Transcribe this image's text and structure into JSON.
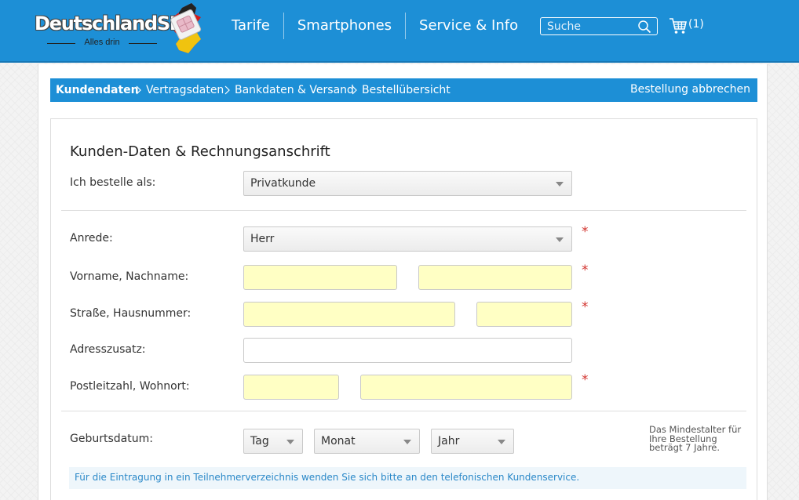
{
  "header": {
    "logo": {
      "brand": "DeutschlandSIM",
      "tagline": "Alles drin"
    },
    "nav": [
      "Tarife",
      "Smartphones",
      "Service & Info"
    ],
    "search": {
      "placeholder": "Suche",
      "value": ""
    },
    "cart": {
      "count": "(1)"
    }
  },
  "checkout": {
    "steps": [
      "Kundendaten",
      "Vertragsdaten",
      "Bankdaten & Versand",
      "Bestellübersicht"
    ],
    "active_step": "Kundendaten",
    "abort_label": "Bestellung abbrechen"
  },
  "form": {
    "title": "Kunden-Daten & Rechnungsanschrift",
    "order_as": {
      "label": "Ich bestelle als:",
      "value": "Privatkunde"
    },
    "salutation": {
      "label": "Anrede:",
      "value": "Herr"
    },
    "name": {
      "label": "Vorname, Nachname:",
      "first": "",
      "last": ""
    },
    "street": {
      "label": "Straße, Hausnummer:",
      "street": "",
      "number": ""
    },
    "address_extra": {
      "label": "Adresszusatz:",
      "value": ""
    },
    "city": {
      "label": "Postleitzahl, Wohnort:",
      "zip": "",
      "city": ""
    },
    "birthdate": {
      "label": "Geburtsdatum:",
      "day": "Tag",
      "month": "Monat",
      "year": "Jahr",
      "hint": "Das Mindestalter für Ihre Bestellung beträgt 7 Jahre."
    },
    "required_marker": "*",
    "notice": "Für die Eintragung in ein Teilnehmerverzeichnis wenden Sie sich bitte an den telefonischen Kundenservice."
  },
  "colors": {
    "brand_blue": "#1d8fd6",
    "required_field": "#ffffc4",
    "required_star": "#d2322d",
    "notice_bg": "#eef6fb",
    "notice_text": "#2a88c8"
  }
}
